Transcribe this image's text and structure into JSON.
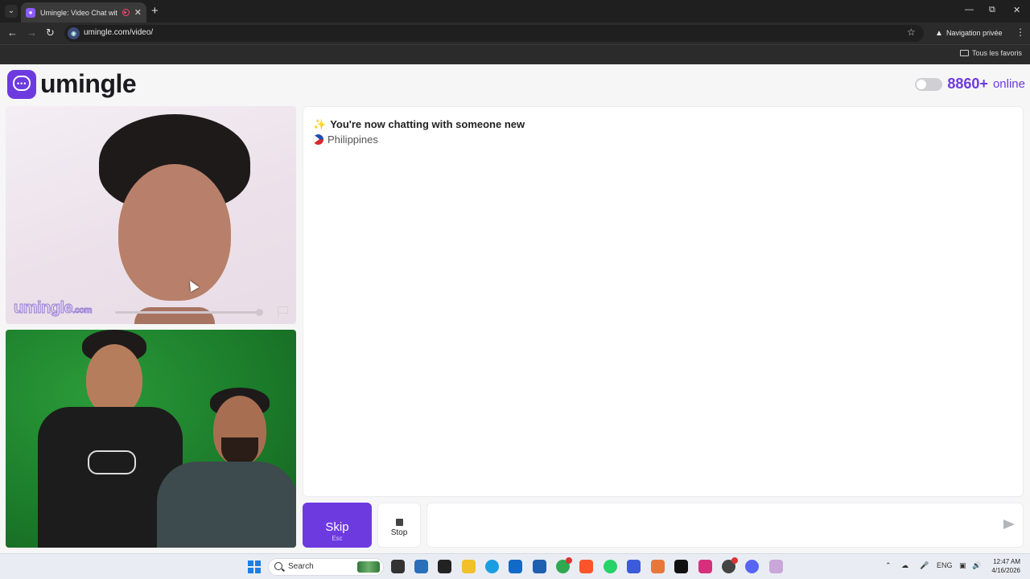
{
  "browser": {
    "tab_title": "Umingle: Video Chat with S",
    "tab_favicon": "chat-bubble-icon",
    "new_tab_symbol": "+",
    "url": "umingle.com/video/",
    "private_label": "Navigation privée",
    "bookmarks_label": "Tous les favoris"
  },
  "site": {
    "logo_text": "umingle",
    "online_count": "8860+",
    "online_label": "online",
    "brand_color": "#6d3ae0"
  },
  "video": {
    "watermark": "umingle",
    "watermark_suffix": ".com"
  },
  "chat": {
    "status_message": "You're now chatting with someone new",
    "country": "Philippines"
  },
  "controls": {
    "skip_label": "Skip",
    "skip_shortcut": "Esc",
    "stop_label": "Stop",
    "message_placeholder": ""
  },
  "taskbar": {
    "search_placeholder": "Search",
    "language": "ENG",
    "time": "12:47 AM",
    "date": "4/16/2026"
  }
}
